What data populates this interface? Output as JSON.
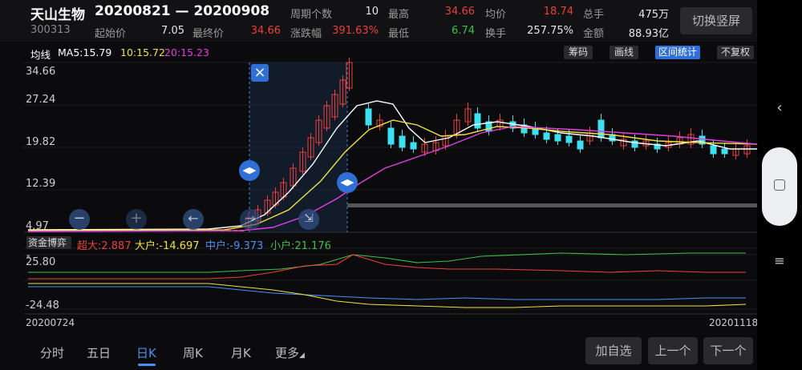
{
  "header": {
    "stock_name": "天山生物",
    "stock_code": "300313",
    "date_range": "20200821 — 20200908",
    "period_count_label": "周期个数",
    "period_count_value": "10",
    "high_label": "最高",
    "high_value": "34.66",
    "avg_label": "均价",
    "avg_value": "18.74",
    "total_vol_label": "总手",
    "total_vol_value": "475万",
    "start_price_label": "起始价",
    "start_price_value": "7.05",
    "end_price_label": "最终价",
    "end_price_value": "34.66",
    "change_label": "涨跌幅",
    "change_value": "391.63%",
    "low_label": "最低",
    "low_value": "6.74",
    "turnover_label": "换手",
    "turnover_value": "257.75%",
    "amount_label": "金额",
    "amount_value": "88.93亿",
    "portrait_button": "切换竖屏"
  },
  "ma_bar": {
    "title": "均线",
    "ma5": "MA5:15.79",
    "ma10": "10:15.72",
    "ma20": "20:15.23"
  },
  "tools": {
    "chips": "筹码",
    "draw": "画线",
    "interval": "区间统计",
    "adjust": "不复权"
  },
  "main_axis": [
    "34.66",
    "27.24",
    "19.82",
    "12.39",
    "4.97"
  ],
  "indicator": {
    "name": "资金博弈",
    "super_big": "超大:2.887",
    "big": "大户:-14.697",
    "mid": "中户:-9.373",
    "small": "小户:21.176",
    "axis_top": "25.80",
    "axis_bottom": "-24.48"
  },
  "dates": {
    "start": "20200724",
    "end": "20201118"
  },
  "nav": {
    "tabs": [
      "分时",
      "五日",
      "日K",
      "周K",
      "月K",
      "更多"
    ],
    "add_fav": "加自选",
    "prev": "上一个",
    "next": "下一个"
  },
  "colors": {
    "up": "#e9403c",
    "down": "#3de0f0",
    "ma5": "#ffffff",
    "ma10": "#f0e040",
    "ma20": "#e040e0",
    "accent": "#2f6fd6"
  },
  "icons": [
    "close-icon",
    "drag-handle-icon",
    "zoom-out-icon",
    "zoom-in-icon",
    "back-arrow-icon",
    "collapse-icon",
    "system-back-icon",
    "system-home-icon",
    "system-menu-icon"
  ]
}
